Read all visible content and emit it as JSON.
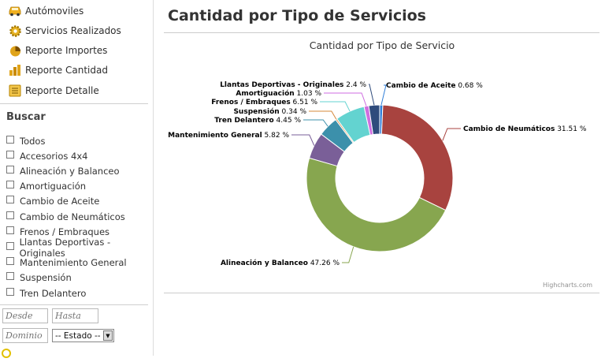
{
  "sidebar": {
    "nav": [
      {
        "label": "Autómoviles",
        "icon": "car-icon"
      },
      {
        "label": "Servicios Realizados",
        "icon": "gear-icon"
      },
      {
        "label": "Reporte Importes",
        "icon": "pie-chart-icon"
      },
      {
        "label": "Reporte Cantidad",
        "icon": "bar-chart-icon"
      },
      {
        "label": "Reporte Detalle",
        "icon": "list-icon"
      }
    ],
    "search_title": "Buscar",
    "filters": [
      "Todos",
      "Accesorios 4x4",
      "Alineación y Balanceo",
      "Amortiguación",
      "Cambio de Aceite",
      "Cambio de Neumáticos",
      "Frenos / Embraques",
      "Llantas Deportivas - Originales",
      "Mantenimiento General",
      "Suspensión",
      "Tren Delantero"
    ],
    "desde_placeholder": "Desde",
    "hasta_placeholder": "Hasta",
    "dominio_placeholder": "Dominio",
    "estado_value": "-- Estado --"
  },
  "main": {
    "title": "Cantidad por Tipo de Servicios"
  },
  "chart_data": {
    "type": "pie",
    "donut": true,
    "title": "Cantidad por Tipo de Servicio",
    "credits": "Highcharts.com",
    "slices": [
      {
        "name": "Cambio de Aceite",
        "value": 0.68,
        "color": "#2f7ed8"
      },
      {
        "name": "Cambio de Neumáticos",
        "value": 31.51,
        "color": "#a8433f"
      },
      {
        "name": "Alineación y Balanceo",
        "value": 47.26,
        "color": "#87a64f"
      },
      {
        "name": "Mantenimiento General",
        "value": 5.82,
        "color": "#7a5f98"
      },
      {
        "name": "Tren Delantero",
        "value": 4.45,
        "color": "#3c90ab"
      },
      {
        "name": "Suspensión",
        "value": 0.34,
        "color": "#d5883b"
      },
      {
        "name": "Frenos / Embraques",
        "value": 6.51,
        "color": "#63d3d0"
      },
      {
        "name": "Amortiguación",
        "value": 1.03,
        "color": "#cf6ee0"
      },
      {
        "name": "Llantas Deportivas - Originales",
        "value": 2.4,
        "color": "#2f4b7c"
      }
    ]
  }
}
